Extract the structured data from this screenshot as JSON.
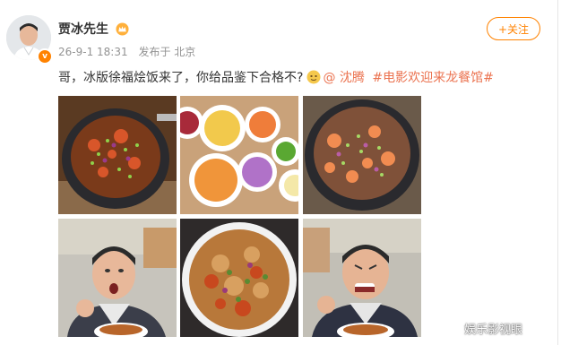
{
  "post": {
    "author": "贾冰先生",
    "time": "26-9-1 18:31",
    "source": "发布于 北京",
    "follow_label": "+关注",
    "text_main": "哥，冰版徐福烩饭来了，你给品鉴下合格不?",
    "mention": "@ 沈腾",
    "topic1": "#电影欢迎来龙餐馆#",
    "emoji": "doge-emoji"
  },
  "watermark": "娱乐影视眼",
  "colors": {
    "accent": "#ff8200",
    "link": "#eb7350"
  },
  "images": [
    "paella-pan-stove",
    "ingredient-bowls",
    "paella-pan-steaming",
    "man-eating-rice-1",
    "paella-closeup-plate",
    "man-eating-rice-2"
  ]
}
